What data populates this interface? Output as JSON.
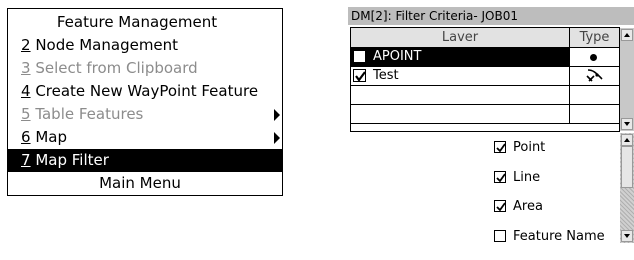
{
  "menu": {
    "title": "Feature Management",
    "items": [
      {
        "num": "2",
        "label": " Node Management",
        "state": "enabled",
        "submenu": false
      },
      {
        "num": "3",
        "label": " Select from Clipboard",
        "state": "disabled",
        "submenu": false
      },
      {
        "num": "4",
        "label": " Create New WayPoint Feature",
        "state": "enabled",
        "submenu": false
      },
      {
        "num": "5",
        "label": " Table Features",
        "state": "disabled",
        "submenu": true
      },
      {
        "num": "6",
        "label": " Map",
        "state": "enabled",
        "submenu": true
      },
      {
        "num": "7",
        "label": " Map Filter",
        "state": "selected",
        "submenu": false
      }
    ],
    "main_menu_label": "Main Menu"
  },
  "dialog": {
    "title": "DM[2]: Filter Criteria- JOB01",
    "table": {
      "columns": [
        "Laver",
        "Type"
      ],
      "rows": [
        {
          "layer": "APOINT",
          "checked": false,
          "selected": true,
          "type_icon": "point-dot-icon"
        },
        {
          "layer": "Test",
          "checked": true,
          "selected": false,
          "type_icon": "crossed-line-icon"
        }
      ]
    },
    "options": [
      {
        "label": "Point",
        "checked": true
      },
      {
        "label": "Line",
        "checked": true
      },
      {
        "label": "Area",
        "checked": true
      },
      {
        "label": "Feature Name",
        "checked": false
      }
    ]
  },
  "colors": {
    "selection": "#000000",
    "title_bar": "#bdbdbd",
    "disabled_text": "#8c8c8c"
  }
}
